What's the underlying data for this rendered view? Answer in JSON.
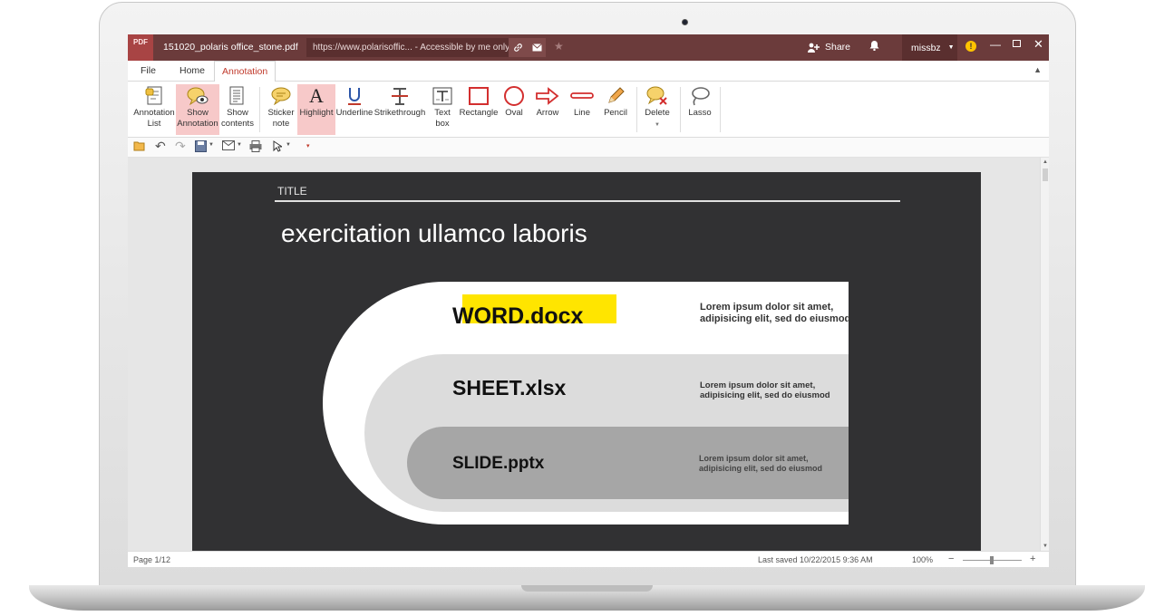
{
  "titlebar": {
    "logo_text": "PDF",
    "document_title": "151020_polaris office_stone.pdf",
    "url": "https://www.polarisoffic... - Accessible by me only",
    "share_label": "Share",
    "username": "missbz",
    "warning_symbol": "!",
    "icons": [
      "link-icon",
      "mail-icon",
      "star-icon",
      "share-icon",
      "bell-icon",
      "warning-icon",
      "minimize-icon",
      "maximize-icon",
      "close-icon"
    ]
  },
  "menu": {
    "tabs": [
      {
        "label": "File"
      },
      {
        "label": "Home"
      },
      {
        "label": "Annotation",
        "active": true
      }
    ]
  },
  "ribbon": {
    "buttons": [
      {
        "label": "Annotation List",
        "icon": "annotation-list-icon"
      },
      {
        "label": "Show Annotation",
        "icon": "show-annotation-icon",
        "active": true
      },
      {
        "label": "Show contents",
        "icon": "show-contents-icon"
      },
      {
        "label": "Sticker note",
        "icon": "sticker-note-icon"
      },
      {
        "label": "Highlight",
        "icon": "highlight-icon",
        "active": true
      },
      {
        "label": "Underline",
        "icon": "underline-icon"
      },
      {
        "label": "Strikethrough",
        "icon": "strikethrough-icon"
      },
      {
        "label": "Text box",
        "icon": "text-box-icon"
      },
      {
        "label": "Rectangle",
        "icon": "rectangle-icon"
      },
      {
        "label": "Oval",
        "icon": "oval-icon"
      },
      {
        "label": "Arrow",
        "icon": "arrow-icon"
      },
      {
        "label": "Line",
        "icon": "line-icon"
      },
      {
        "label": "Pencil",
        "icon": "pencil-icon"
      },
      {
        "label": "Delete",
        "icon": "delete-annotation-icon"
      },
      {
        "label": "Lasso",
        "icon": "lasso-icon"
      }
    ]
  },
  "quickbar": {
    "icons": [
      "open-folder-icon",
      "undo-icon",
      "redo-icon",
      "save-icon",
      "email-icon",
      "print-icon",
      "select-cursor-icon",
      "customize-icon"
    ]
  },
  "slide": {
    "label": "TITLE",
    "heading": "exercitation ullamco laboris",
    "items": [
      {
        "title": "WORD.docx",
        "desc": "Lorem ipsum dolor sit amet, adipisicing elit, sed do eiusmod"
      },
      {
        "title": "SHEET.xlsx",
        "desc": "Lorem ipsum dolor sit amet, adipisicing elit, sed do eiusmod"
      },
      {
        "title": "SLIDE.pptx",
        "desc": "Lorem ipsum dolor sit amet, adipisicing elit, sed do eiusmod"
      }
    ]
  },
  "statusbar": {
    "page": "Page 1/12",
    "last_saved": "Last saved 10/22/2015 9:36 AM",
    "zoom": "100%",
    "zoom_out": "−",
    "zoom_in": "+"
  },
  "colors": {
    "titlebar": "#6b3b3b",
    "accent": "#c0392b",
    "highlight": "#ffe500",
    "ribbon_active": "#f7c9c9",
    "slide_bg": "#313133"
  }
}
